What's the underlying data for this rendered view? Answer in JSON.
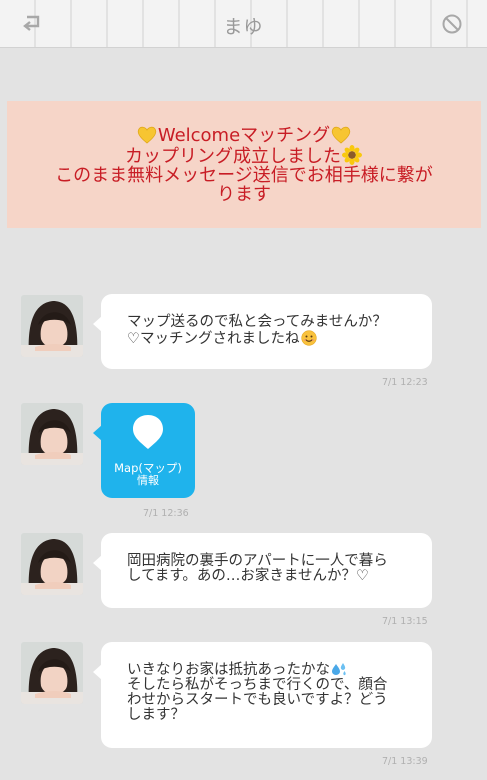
{
  "header": {
    "title": "まゆ"
  },
  "banner": {
    "line1_text": "Welcomeマッチング",
    "line2_text": "カップリング成立しました",
    "line3_text": "このまま無料メッセージ送信でお相手様に繋が",
    "line4_text": "ります"
  },
  "messages": [
    {
      "line1": "マップ送るので私と会ってみませんか？",
      "line2": "♡マッチングされましたね",
      "time": "7/1 12:23"
    },
    {
      "map_label": "Map(マップ)",
      "map_sub": "情報",
      "time": "7/1 12:36"
    },
    {
      "line1": "岡田病院の裏手のアパートに一人で暮ら",
      "line2": "してます。あの…お家きませんか？♡",
      "time": "7/1 13:15"
    },
    {
      "line1": "いきなりお家は抵抗あったかな",
      "line2": "そしたら私がそっちまで行くので、顔合",
      "line3": "わせからスタートでも良いですよ？どう",
      "line4": "します？",
      "time": "7/1 13:39"
    }
  ],
  "colors": {
    "banner_bg": "#f6d5c8",
    "banner_text": "#c81d25",
    "map_bubble": "#1fb3ec"
  },
  "icons": {
    "back": "back-arrow-icon",
    "block": "block-icon",
    "heart": "yellow-heart-icon",
    "flower": "sunflower-icon",
    "smile": "smile-emoji-icon",
    "sweat": "sweat-droplets-icon",
    "map_pin": "map-pin-icon"
  }
}
